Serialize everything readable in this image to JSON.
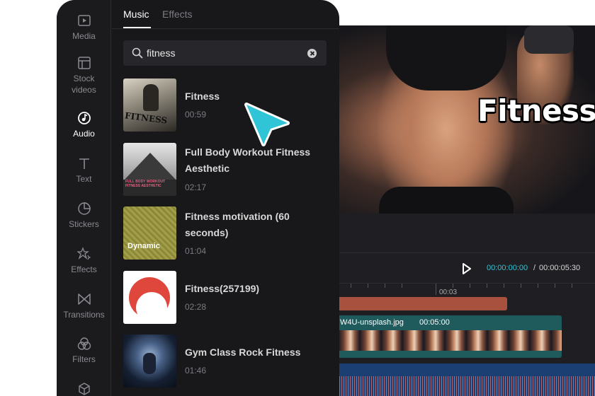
{
  "colors": {
    "panel_bg": "#18181b",
    "accent_teal": "#2fc4d6",
    "text_track": "#a9513f",
    "video_track": "#1f5a5c",
    "audio_track": "#1b3f73"
  },
  "sidebar": {
    "items": [
      {
        "label": "Media",
        "icon": "media-icon"
      },
      {
        "label": "Stock videos",
        "icon": "stock-videos-icon"
      },
      {
        "label": "Audio",
        "icon": "audio-icon",
        "active": true
      },
      {
        "label": "Text",
        "icon": "text-icon"
      },
      {
        "label": "Stickers",
        "icon": "stickers-icon"
      },
      {
        "label": "Effects",
        "icon": "effects-icon"
      },
      {
        "label": "Transitions",
        "icon": "transitions-icon"
      },
      {
        "label": "Filters",
        "icon": "filters-icon"
      },
      {
        "label": "",
        "icon": "cube-icon"
      }
    ]
  },
  "tabs": {
    "music": "Music",
    "effects": "Effects",
    "active": "Music"
  },
  "search": {
    "value": "fitness",
    "placeholder": ""
  },
  "music_list": [
    {
      "title": "Fitness",
      "duration": "00:59",
      "thumb_text": "FITNESS"
    },
    {
      "title": "Full Body Workout Fitness Aesthetic",
      "duration": "02:17",
      "thumb_text": "FULL BODY WORKOUT FITNESS AESTHETIC"
    },
    {
      "title": "Fitness motivation (60 seconds)",
      "duration": "01:04",
      "thumb_text": "Dynamic"
    },
    {
      "title": "Fitness(257199)",
      "duration": "02:28",
      "thumb_text": ""
    },
    {
      "title": "Gym Class Rock Fitness",
      "duration": "01:46",
      "thumb_text": ""
    }
  ],
  "preview": {
    "overlay_title": "Fitness"
  },
  "player": {
    "current_time": "00:00:00:00",
    "separator": "/",
    "total_time": "00:00:05:30"
  },
  "timeline": {
    "ruler_label": "00:03",
    "video_clip": {
      "name": "W4U-unsplash.jpg",
      "duration": "00:05:00"
    }
  }
}
